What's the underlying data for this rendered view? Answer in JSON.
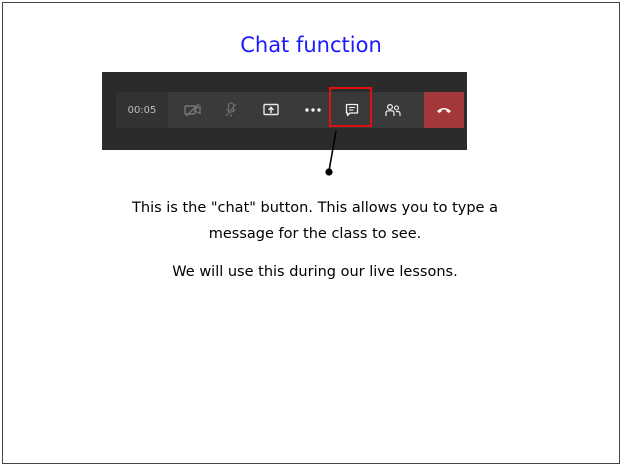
{
  "slide": {
    "title": "Chat function",
    "description_lines": [
      "This is the \"chat\" button. This allows you to type a",
      "message for the class to see."
    ],
    "note": "We will use this during our live lessons."
  },
  "toolbar": {
    "timer": "00:05",
    "icons": [
      "camera-off-icon",
      "mic-off-icon",
      "share-screen-icon",
      "more-options-icon",
      "chat-icon",
      "participants-icon",
      "hang-up-icon"
    ],
    "colors": {
      "toolbar_bg": "#3a3a3a",
      "outer_bg": "#2b2b2b",
      "hangup": "#a4373a",
      "highlight": "#e01010",
      "title": "#1a1aff"
    }
  }
}
